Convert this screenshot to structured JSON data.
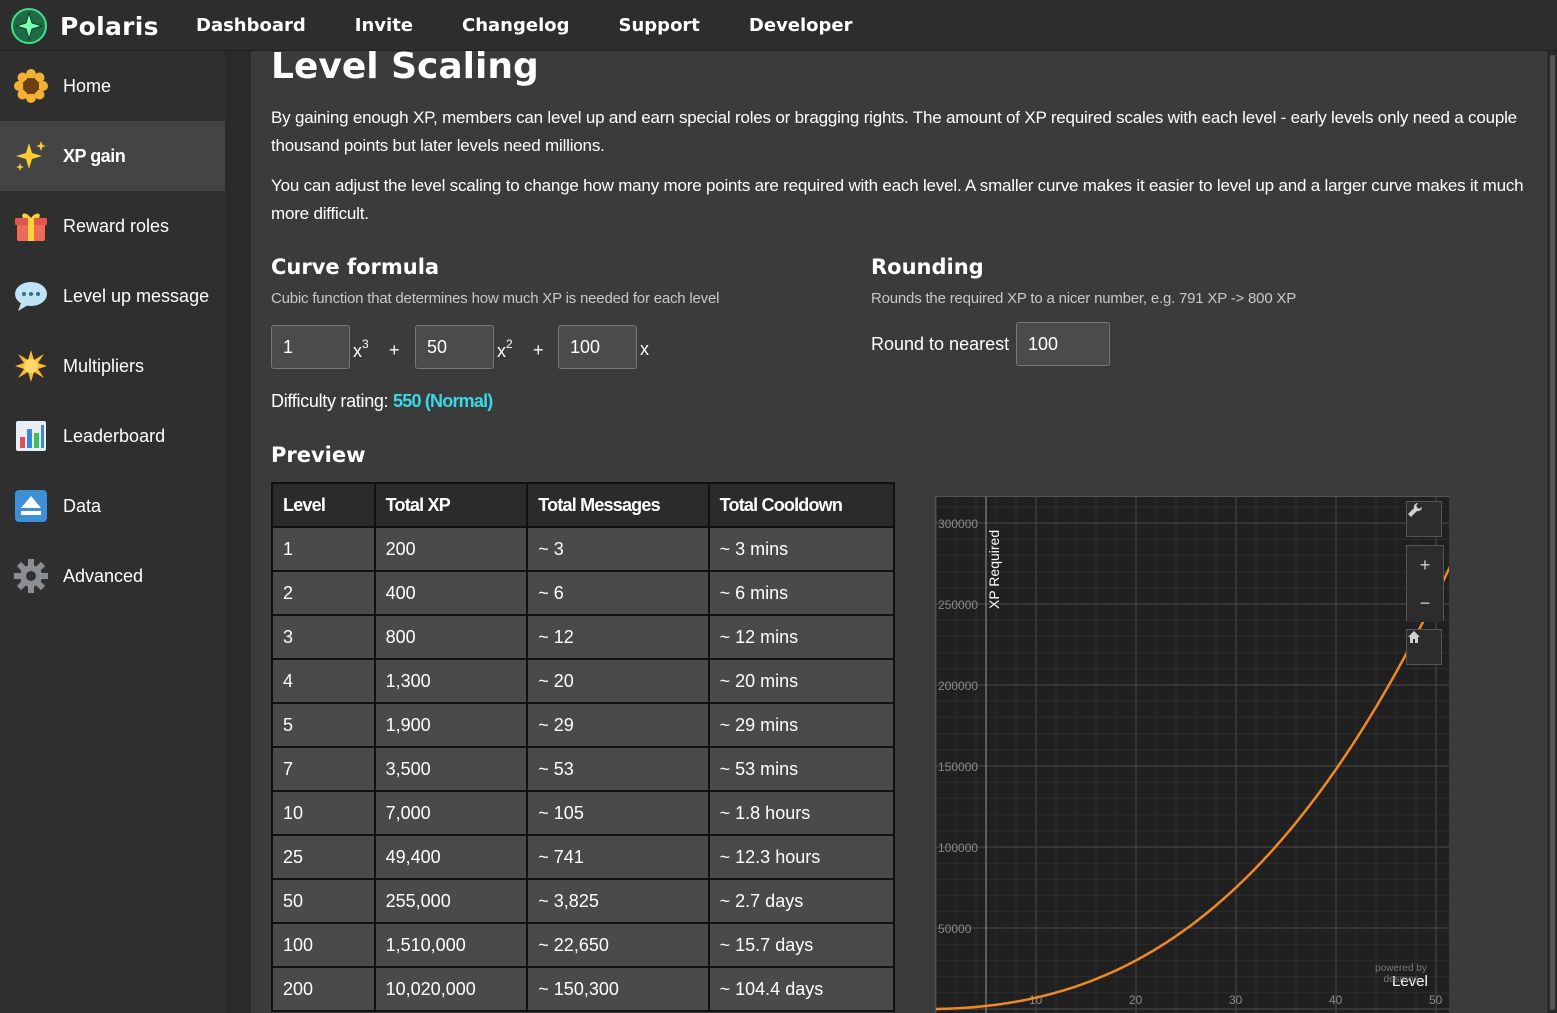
{
  "app": {
    "name": "Polaris"
  },
  "nav": [
    "Dashboard",
    "Invite",
    "Changelog",
    "Support",
    "Developer"
  ],
  "sidebar": {
    "items": [
      {
        "label": "Home",
        "icon": "sunflower-icon"
      },
      {
        "label": "XP gain",
        "icon": "sparkles-icon",
        "active": true
      },
      {
        "label": "Reward roles",
        "icon": "gift-icon"
      },
      {
        "label": "Level up message",
        "icon": "speech-bubble-icon"
      },
      {
        "label": "Multipliers",
        "icon": "burst-icon"
      },
      {
        "label": "Leaderboard",
        "icon": "bar-chart-icon"
      },
      {
        "label": "Data",
        "icon": "eject-icon"
      },
      {
        "label": "Advanced",
        "icon": "gear-icon"
      }
    ]
  },
  "page": {
    "title": "Level Scaling",
    "para1": "By gaining enough XP, members can level up and earn special roles or bragging rights. The amount of XP required scales with each level - early levels only need a couple thousand points but later levels need millions.",
    "para2": "You can adjust the level scaling to change how many more points are required with each level. A smaller curve makes it easier to level up and a larger curve makes it much more difficult."
  },
  "curve": {
    "title": "Curve formula",
    "subtitle": "Cubic function that determines how much XP is needed for each level",
    "coef_x3": "1",
    "coef_x2": "50",
    "coef_x": "100",
    "x": "x",
    "exp3": "3",
    "exp2": "2",
    "plus": "+",
    "difficulty_label": "Difficulty rating:",
    "difficulty_value": "550 (Normal)"
  },
  "rounding": {
    "title": "Rounding",
    "subtitle": "Rounds the required XP to a nicer number, e.g. 791 XP -> 800 XP",
    "label": "Round to nearest",
    "value": "100"
  },
  "preview": {
    "title": "Preview",
    "headers": [
      "Level",
      "Total XP",
      "Total Messages",
      "Total Cooldown"
    ],
    "rows": [
      [
        "1",
        "200",
        "~ 3",
        "~ 3 mins"
      ],
      [
        "2",
        "400",
        "~ 6",
        "~ 6 mins"
      ],
      [
        "3",
        "800",
        "~ 12",
        "~ 12 mins"
      ],
      [
        "4",
        "1,300",
        "~ 20",
        "~ 20 mins"
      ],
      [
        "5",
        "1,900",
        "~ 29",
        "~ 29 mins"
      ],
      [
        "7",
        "3,500",
        "~ 53",
        "~ 53 mins"
      ],
      [
        "10",
        "7,000",
        "~ 105",
        "~ 1.8 hours"
      ],
      [
        "25",
        "49,400",
        "~ 741",
        "~ 12.3 hours"
      ],
      [
        "50",
        "255,000",
        "~ 3,825",
        "~ 2.7 days"
      ],
      [
        "100",
        "1,510,000",
        "~ 22,650",
        "~ 15.7 days"
      ],
      [
        "200",
        "10,020,000",
        "~ 150,300",
        "~ 104.4 days"
      ]
    ]
  },
  "chart_data": {
    "type": "line",
    "xlabel": "Level",
    "ylabel": "XP Required",
    "x_ticks": [
      "10",
      "20",
      "30",
      "40",
      "50"
    ],
    "y_ticks": [
      "50000",
      "100000",
      "150000",
      "200000",
      "250000",
      "300000"
    ],
    "xlim": [
      0,
      50
    ],
    "ylim": [
      0,
      300000
    ],
    "formula": "x^3 + 50x^2 + 100x",
    "series": [
      {
        "color": "#f08a24"
      }
    ],
    "grid": true,
    "controls": [
      "wrench-icon",
      "zoom-in-icon",
      "zoom-out-icon",
      "home-icon"
    ],
    "watermark": "powered by desmos"
  }
}
